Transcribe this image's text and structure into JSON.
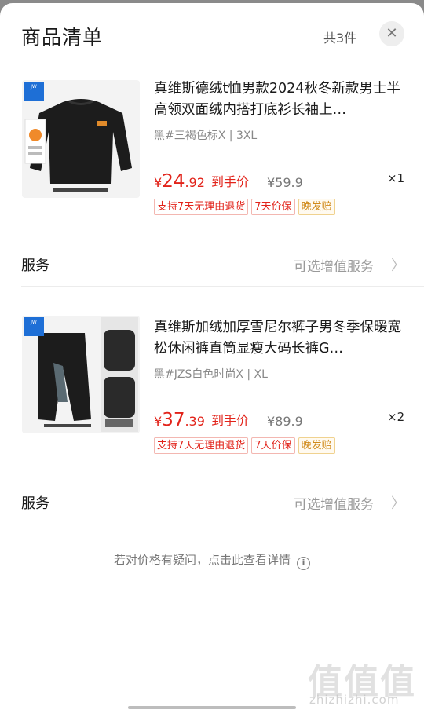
{
  "header": {
    "title": "商品清单",
    "count": "共3件",
    "close_symbol": "✕"
  },
  "items": [
    {
      "title": "真维斯德绒t恤男款2024秋冬新款男士半高领双面绒内搭打底衫长袖上…",
      "spec": "黑#三褐色标X | 3XL",
      "price_yen": "¥",
      "price_int": "24",
      "price_dec": ".92",
      "final_label": "到手价",
      "original_price": "¥59.9",
      "qty": "×1",
      "tags": [
        "支持7天无理由退货",
        "7天价保",
        "晚发赔"
      ],
      "image": "black-sweater-product-image"
    },
    {
      "title": "真维斯加绒加厚雪尼尔裤子男冬季保暖宽松休闲裤直筒显瘦大码长裤G…",
      "spec": "黑#JZS白色时尚X | XL",
      "price_yen": "¥",
      "price_int": "37",
      "price_dec": ".39",
      "final_label": "到手价",
      "original_price": "¥89.9",
      "qty": "×2",
      "tags": [
        "支持7天无理由退货",
        "7天价保",
        "晚发赔"
      ],
      "image": "black-pants-product-image"
    }
  ],
  "service": {
    "label": "服务",
    "value": "可选增值服务",
    "chevron": "〉"
  },
  "footer": {
    "note": "若对价格有疑问，点击此查看详情",
    "info_icon": "i"
  },
  "watermark": {
    "text": "值值值",
    "url": "zhizhizhi.com"
  },
  "colors": {
    "price_red": "#e2231a",
    "tag_gold": "#d08a1a"
  }
}
